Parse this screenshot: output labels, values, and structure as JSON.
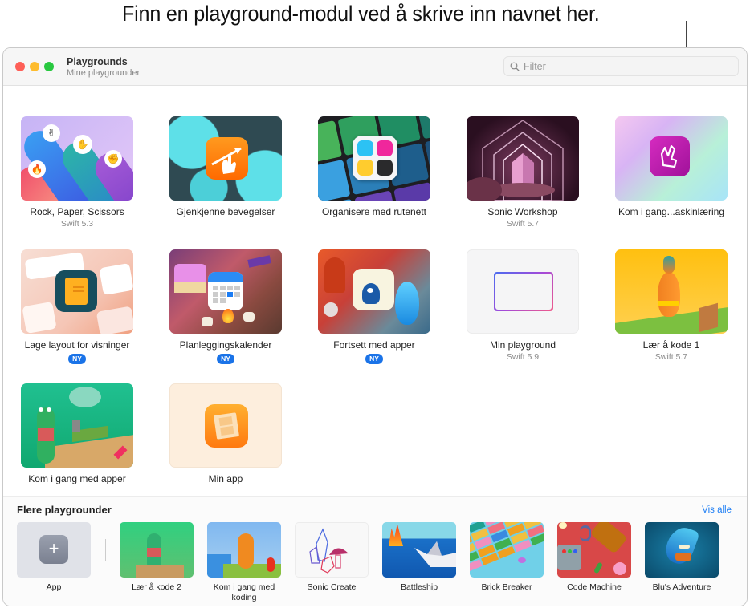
{
  "callout": {
    "text": "Finn en playground-modul ved å skrive inn navnet her."
  },
  "window": {
    "title": "Playgrounds",
    "subtitle": "Mine playgrounder",
    "search": {
      "placeholder": "Filter",
      "value": ""
    }
  },
  "my_playgrounds": [
    {
      "name": "Rock, Paper, Scissors",
      "sub": "Swift 5.3",
      "badge": ""
    },
    {
      "name": "Gjenkjenne bevegelser",
      "sub": "",
      "badge": ""
    },
    {
      "name": "Organisere med rutenett",
      "sub": "",
      "badge": ""
    },
    {
      "name": "Sonic Workshop",
      "sub": "Swift 5.7",
      "badge": ""
    },
    {
      "name": "Kom i gang...askinlæring",
      "sub": "",
      "badge": ""
    },
    {
      "name": "Lage layout for visninger",
      "sub": "",
      "badge": "NY"
    },
    {
      "name": "Planleggingskalender",
      "sub": "",
      "badge": "NY"
    },
    {
      "name": "Fortsett med apper",
      "sub": "",
      "badge": "NY"
    },
    {
      "name": "Min playground",
      "sub": "Swift 5.9",
      "badge": ""
    },
    {
      "name": "Lær å kode 1",
      "sub": "Swift 5.7",
      "badge": ""
    },
    {
      "name": "Kom i gang med apper",
      "sub": "",
      "badge": ""
    },
    {
      "name": "Min app",
      "sub": "",
      "badge": ""
    }
  ],
  "more": {
    "title": "Flere playgrounder",
    "see_all": "Vis alle",
    "items": [
      {
        "name": "App"
      },
      {
        "name": "Lær å kode 2"
      },
      {
        "name": "Kom i gang med koding"
      },
      {
        "name": "Sonic Create"
      },
      {
        "name": "Battleship"
      },
      {
        "name": "Brick Breaker"
      },
      {
        "name": "Code Machine"
      },
      {
        "name": "Blu's Adventure"
      }
    ]
  },
  "colors": {
    "accent": "#1a7cf4",
    "badge": "#1a73e8"
  }
}
